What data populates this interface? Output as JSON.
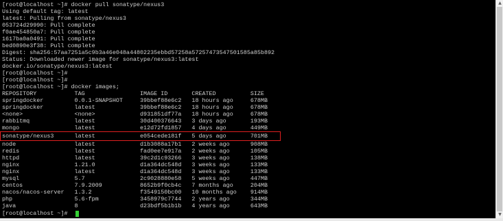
{
  "terminal": {
    "lines": [
      "[root@localhost ~]# docker pull sonatype/nexus3",
      "Using default tag: latest",
      "latest: Pulling from sonatype/nexus3",
      "053724d29990: Pull complete",
      "f0ae454850a7: Pull complete",
      "1617ba0a0491: Pull complete",
      "bed0890e3f38: Pull complete",
      "Digest: sha256:57aa7251a5c9b3a46e048a44802235ebbd57258a57257473547501585a85b892",
      "Status: Downloaded newer image for sonatype/nexus3:latest",
      "docker.io/sonatype/nexus3:latest",
      "[root@localhost ~]#",
      "[root@localhost ~]#",
      "[root@localhost ~]# docker images;",
      "REPOSITORY           TAG                IMAGE ID       CREATED          SIZE",
      "springdocker         0.0.1-SNAPSHOT     39bbef88e6c2   18 hours ago     678MB",
      "springdocker         latest             39bbef88e6c2   18 hours ago     678MB",
      "<none>               <none>             d931851df77a   18 hours ago     678MB",
      "rabbitmq             latest             30d400376643   3 days ago       193MB",
      "mongo                latest             e12d72fd1857   4 days ago       449MB",
      "sonatype/nexus3      latest             e054cede181f   5 days ago       701MB",
      "node                 latest             d1b3088a17b1   2 weeks ago      908MB",
      "redis                latest             fad0ee7e917a   2 weeks ago      105MB",
      "httpd                latest             39c2d1c93266   3 weeks ago      138MB",
      "nginx                1.21.0             d1a364dc548d   3 weeks ago      133MB",
      "nginx                latest             d1a364dc548d   3 weeks ago      133MB",
      "mysql                5.7                2c9028880e58   5 weeks ago      447MB",
      "centos               7.9.2009           8652b9f0cb4c   7 months ago     204MB",
      "nacos/nacos-server   1.3.2              f3549150bc00   10 months ago    914MB",
      "php                  5.6-fpm            3458979c7744   2 years ago      344MB",
      "java                 8                  d23bdf5b1b1b   4 years ago      643MB",
      "[root@localhost ~]#"
    ],
    "highlighted_row": "sonatype/nexus3      latest             e054cede181f   5 days ago       701MB",
    "cursor_color": "#34d134",
    "highlight_color": "#e02020"
  }
}
